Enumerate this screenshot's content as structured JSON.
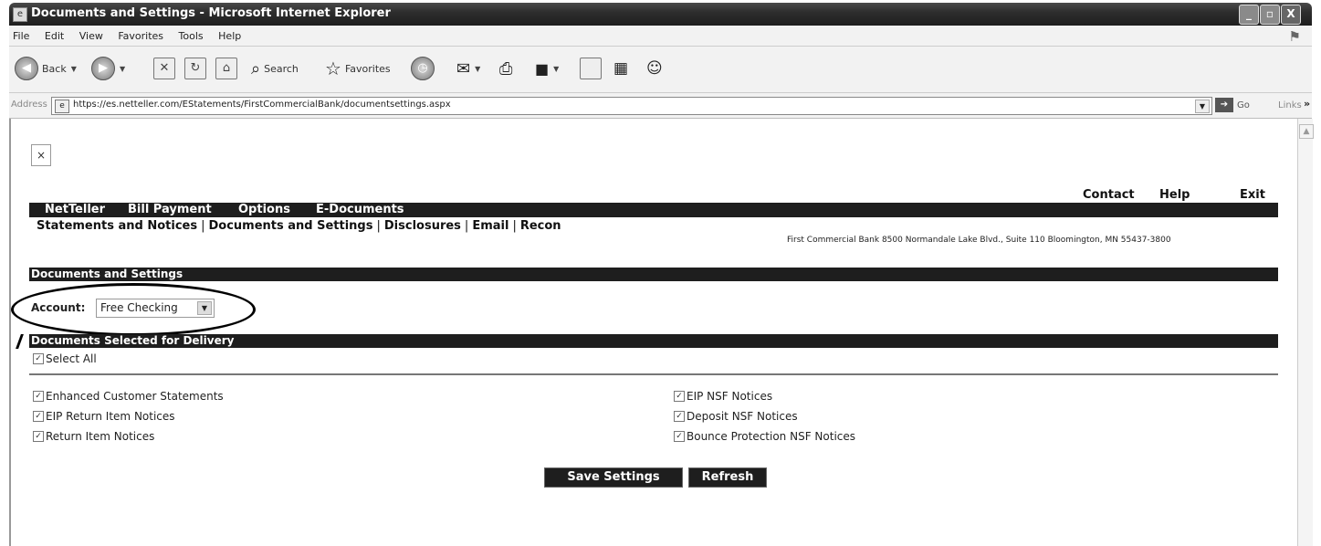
{
  "window": {
    "title": "Documents and Settings - Microsoft Internet Explorer",
    "controls": [
      "_",
      "▫",
      "X"
    ]
  },
  "menu": [
    "File",
    "Edit",
    "View",
    "Favorites",
    "Tools",
    "Help"
  ],
  "toolbar": {
    "back": "Back",
    "search": "Search",
    "favorites": "Favorites"
  },
  "address": {
    "label": "Address",
    "url": "https://es.netteller.com/EStatements/FirstCommercialBank/documentsettings.aspx",
    "go": "Go",
    "links": "Links",
    "chevron": "»"
  },
  "toplinks": {
    "contact": "Contact",
    "help": "Help",
    "exit": "Exit"
  },
  "nav": [
    "NetTeller",
    "Bill Payment",
    "Options",
    "E-Documents"
  ],
  "subnav": [
    "Statements and Notices",
    "Documents and Settings",
    "Disclosures",
    "Email",
    "Recon"
  ],
  "bank_address": "First Commercial Bank 8500 Normandale Lake Blvd., Suite 110 Bloomington, MN 55437-3800",
  "sections": {
    "settings_title": "Documents and Settings",
    "delivery_title": "Documents Selected for Delivery"
  },
  "account": {
    "label": "Account:",
    "value": "Free Checking"
  },
  "select_all": {
    "label": "Select All",
    "checked": true
  },
  "documents_left": [
    {
      "label": "Enhanced Customer Statements",
      "checked": true
    },
    {
      "label": "EIP Return Item Notices",
      "checked": true
    },
    {
      "label": "Return Item Notices",
      "checked": true
    }
  ],
  "documents_right": [
    {
      "label": "EIP NSF Notices",
      "checked": true
    },
    {
      "label": "Deposit NSF Notices",
      "checked": true
    },
    {
      "label": "Bounce Protection NSF Notices",
      "checked": true
    }
  ],
  "buttons": {
    "save": "Save Settings",
    "refresh": "Refresh"
  },
  "glyphs": {
    "check": "✓",
    "broken_image": "×",
    "dropdown": "▼",
    "scroll_up": "▲"
  }
}
